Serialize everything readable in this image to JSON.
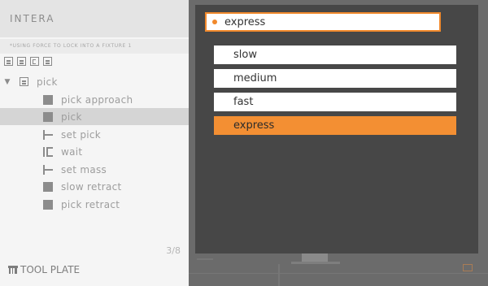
{
  "app": {
    "title": "INTERA",
    "subtitle": "*USING FORCE TO LOCK INTO A FIXTURE 1"
  },
  "toolbar": {
    "icons": [
      "list-icon",
      "list-icon",
      "collapse-icon",
      "list-icon"
    ]
  },
  "tree": {
    "parent": {
      "label": "pick",
      "expanded": true
    },
    "items": [
      {
        "label": "pick approach",
        "icon": "square",
        "selected": false
      },
      {
        "label": "pick",
        "icon": "square",
        "selected": true
      },
      {
        "label": "set pick",
        "icon": "tee",
        "selected": false
      },
      {
        "label": "wait",
        "icon": "wait",
        "selected": false
      },
      {
        "label": "set mass",
        "icon": "tee",
        "selected": false
      },
      {
        "label": "slow retract",
        "icon": "square",
        "selected": false
      },
      {
        "label": "pick retract",
        "icon": "square",
        "selected": false
      }
    ]
  },
  "counter": "3/8",
  "footer": {
    "label": "TOOL PLATE"
  },
  "speed_dropdown": {
    "current": "express",
    "options": [
      "slow",
      "medium",
      "fast",
      "express"
    ],
    "accent": "#f38f33"
  }
}
